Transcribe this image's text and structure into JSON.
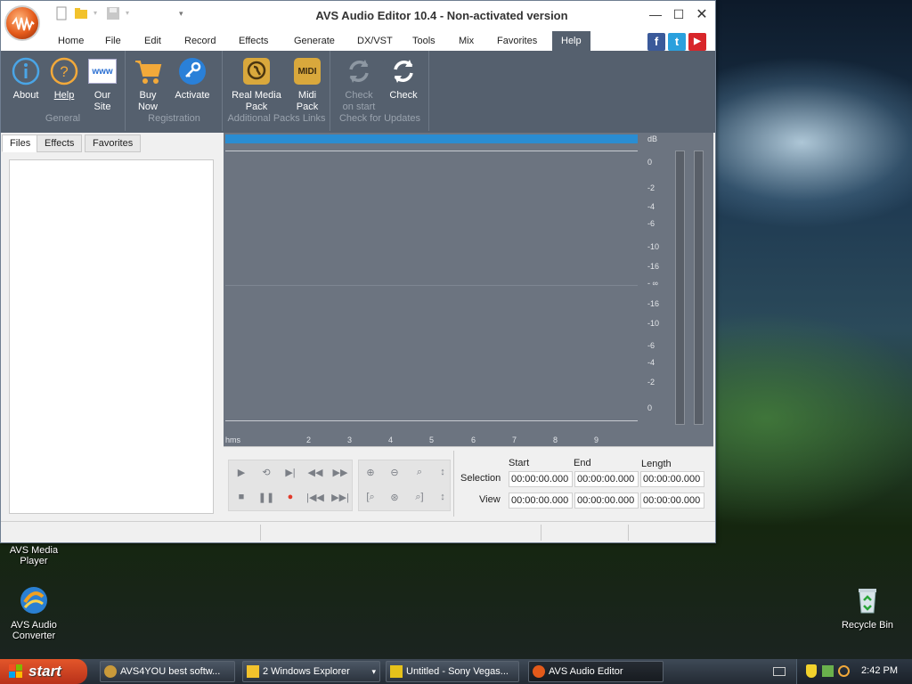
{
  "window": {
    "title": "AVS Audio Editor 10.4 - Non-activated version",
    "controls": {
      "minimize": "—",
      "maximize": "☐",
      "close": "✕"
    }
  },
  "menu": [
    "Home",
    "File",
    "Edit",
    "Record",
    "Effects",
    "Generate",
    "DX/VST",
    "Tools",
    "Mix",
    "Favorites",
    "Help"
  ],
  "menu_active": "Help",
  "social": {
    "facebook": "f",
    "twitter": "t",
    "youtube": "▶"
  },
  "ribbon": {
    "groups": [
      {
        "name": "General",
        "buttons": [
          {
            "label": "About"
          },
          {
            "label": "Help"
          },
          {
            "label": "Our\nSite"
          }
        ]
      },
      {
        "name": "Registration",
        "buttons": [
          {
            "label": "Buy\nNow"
          },
          {
            "label": "Activate"
          }
        ]
      },
      {
        "name": "Additional Packs Links",
        "buttons": [
          {
            "label": "Real Media\nPack"
          },
          {
            "label": "Midi\nPack"
          }
        ]
      },
      {
        "name": "Check for Updates",
        "buttons": [
          {
            "label": "Check\non start"
          },
          {
            "label": "Check"
          }
        ]
      }
    ],
    "icon_text": {
      "our_site": "www",
      "midi": "MIDI"
    }
  },
  "left_tabs": [
    "Files",
    "Effects",
    "Favorites"
  ],
  "db_scale": [
    "dB",
    "0",
    "-2",
    "-4",
    "-6",
    "-10",
    "-16",
    "- ∞",
    "-16",
    "-10",
    "-6",
    "-4",
    "-2",
    "0"
  ],
  "timeline": [
    "hms",
    "2",
    "3",
    "4",
    "5",
    "6",
    "7",
    "8",
    "9"
  ],
  "selection": {
    "headers": [
      "Start",
      "End",
      "Length"
    ],
    "selection_label": "Selection",
    "view_label": "View",
    "selection_values": [
      "00:00:00.000",
      "00:00:00.000",
      "00:00:00.000"
    ],
    "view_values": [
      "00:00:00.000",
      "00:00:00.000",
      "00:00:00.000"
    ]
  },
  "desktop_icons": [
    {
      "label": "AVS Media\nPlayer"
    },
    {
      "label": "AVS Audio\nConverter"
    },
    {
      "label": "Recycle Bin"
    }
  ],
  "taskbar": {
    "start": "start",
    "tasks": [
      "AVS4YOU best softw...",
      "2 Windows Explorer",
      "Untitled - Sony Vegas...",
      "AVS Audio Editor"
    ],
    "clock": "2:42 PM"
  },
  "colors": {
    "ribbon": "#55606e",
    "wave_bg": "#6c7480",
    "accent_blue": "#2a8dd2"
  }
}
